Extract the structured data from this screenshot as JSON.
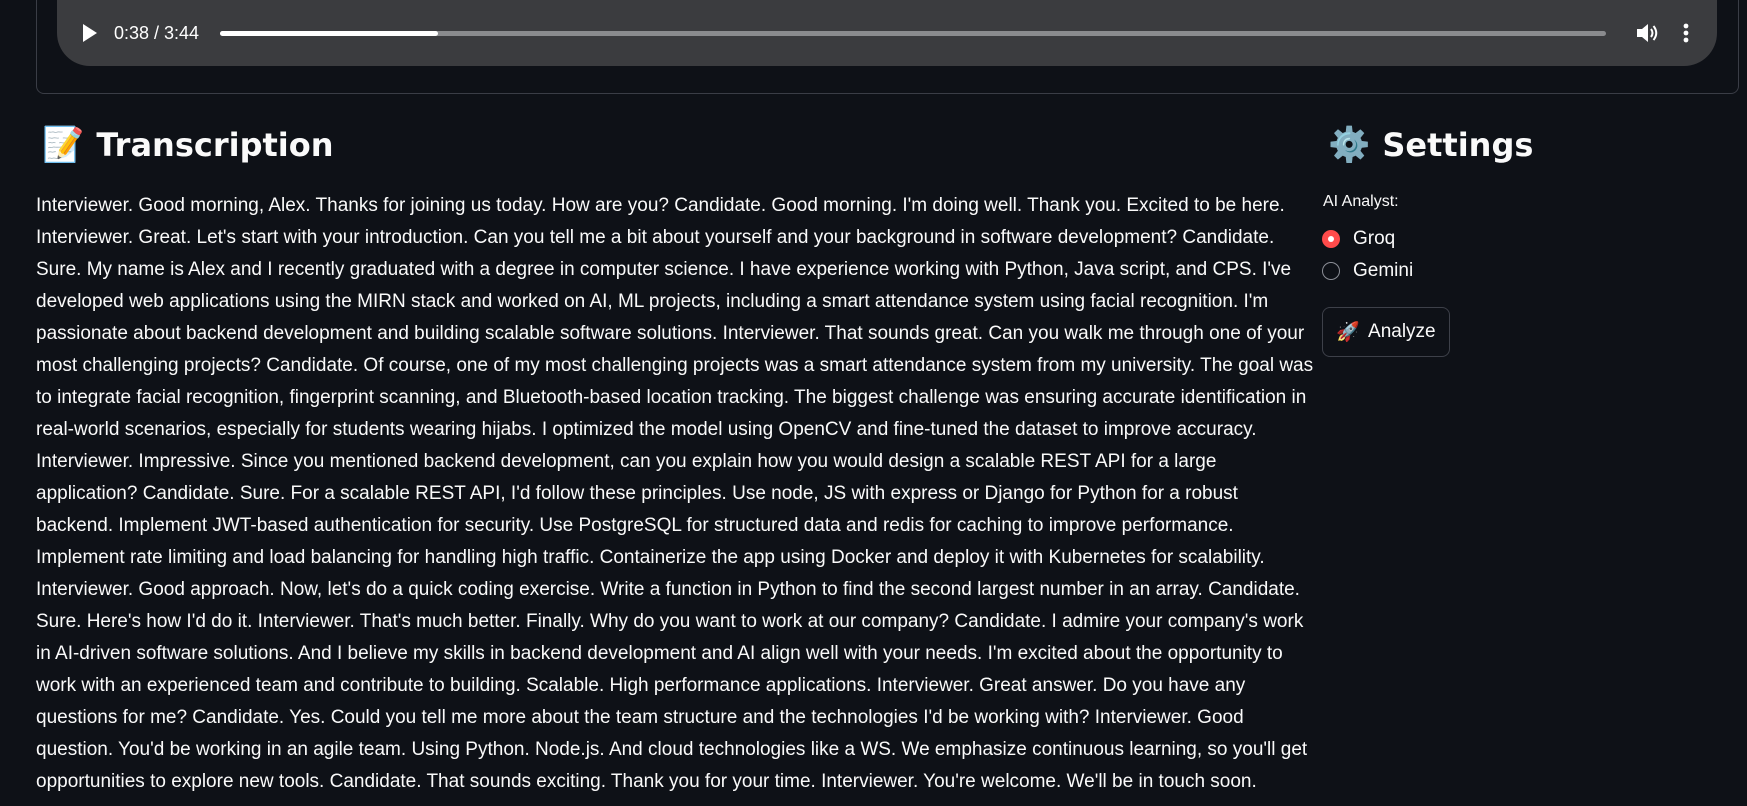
{
  "audio_player": {
    "time_display": "0:38 / 3:44",
    "progress_fraction": 0.157,
    "play_icon": "play-icon",
    "volume_icon": "volume-icon",
    "more_icon": "more-vertical-icon"
  },
  "transcription": {
    "heading_icon": "📝",
    "heading": "Transcription",
    "text": "Interviewer. Good morning, Alex. Thanks for joining us today. How are you? Candidate. Good morning. I'm doing well. Thank you. Excited to be here. Interviewer. Great. Let's start with your introduction. Can you tell me a bit about yourself and your background in software development? Candidate. Sure. My name is Alex and I recently graduated with a degree in computer science. I have experience working with Python, Java script, and CPS. I've developed web applications using the MIRN stack and worked on AI, ML projects, including a smart attendance system using facial recognition. I'm passionate about backend development and building scalable software solutions. Interviewer. That sounds great. Can you walk me through one of your most challenging projects? Candidate. Of course, one of my most challenging projects was a smart attendance system from my university. The goal was to integrate facial recognition, fingerprint scanning, and Bluetooth-based location tracking. The biggest challenge was ensuring accurate identification in real-world scenarios, especially for students wearing hijabs. I optimized the model using OpenCV and fine-tuned the dataset to improve accuracy. Interviewer. Impressive. Since you mentioned backend development, can you explain how you would design a scalable REST API for a large application? Candidate. Sure. For a scalable REST API, I'd follow these principles. Use node, JS with express or Django for Python for a robust backend. Implement JWT-based authentication for security. Use PostgreSQL for structured data and redis for caching to improve performance. Implement rate limiting and load balancing for handling high traffic. Containerize the app using Docker and deploy it with Kubernetes for scalability. Interviewer. Good approach. Now, let's do a quick coding exercise. Write a function in Python to find the second largest number in an array. Candidate. Sure. Here's how I'd do it. Interviewer. That's much better. Finally. Why do you want to work at our company? Candidate. I admire your company's work in AI-driven software solutions. And I believe my skills in backend development and AI align well with your needs. I'm excited about the opportunity to work with an experienced team and contribute to building. Scalable. High performance applications. Interviewer. Great answer. Do you have any questions for me? Candidate. Yes. Could you tell me more about the team structure and the technologies I'd be working with? Interviewer. Good question. You'd be working in an agile team. Using Python. Node.js. And cloud technologies like a WS. We emphasize continuous learning, so you'll get opportunities to explore new tools. Candidate. That sounds exciting. Thank you for your time. Interviewer. You're welcome. We'll be in touch soon."
  },
  "settings": {
    "heading_icon": "⚙️",
    "heading": "Settings",
    "analyst_label": "AI Analyst:",
    "options": [
      {
        "label": "Groq",
        "selected": true
      },
      {
        "label": "Gemini",
        "selected": false
      }
    ],
    "analyze_icon": "🚀",
    "analyze_label": "Analyze"
  },
  "colors": {
    "background": "#0e1117",
    "accent": "#ff4b4b",
    "player_bg": "#3b3c3f",
    "text": "#fafafa"
  }
}
